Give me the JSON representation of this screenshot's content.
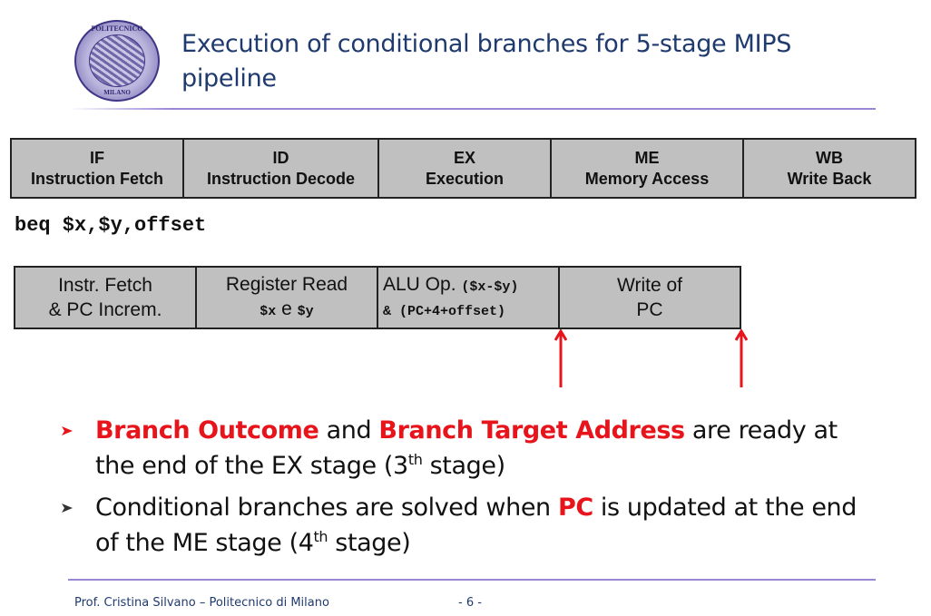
{
  "header": {
    "logo": {
      "top_text": "POLITECNICO",
      "bottom_text": "MILANO"
    },
    "title": "Execution of conditional branches for 5-stage MIPS pipeline"
  },
  "pipeline_stages": [
    {
      "abbr": "IF",
      "name": "Instruction Fetch"
    },
    {
      "abbr": "ID",
      "name": "Instruction Decode"
    },
    {
      "abbr": "EX",
      "name": "Execution"
    },
    {
      "abbr": "ME",
      "name": "Memory Access"
    },
    {
      "abbr": "WB",
      "name": "Write Back"
    }
  ],
  "instruction": "beq $x,$y,offset",
  "operations": [
    {
      "line1": "Instr. Fetch",
      "line2": "& PC Increm."
    },
    {
      "line1": "Register Read",
      "line2_a": "$x",
      "line2_b": " e ",
      "line2_c": "$y"
    },
    {
      "line1_a": "ALU Op. ",
      "line1_b": "($x-$y)",
      "line2": "& (PC+4+offset)"
    },
    {
      "line1": "Write of",
      "line2": "PC"
    }
  ],
  "arrows": [
    {
      "label": "end-of-EX-arrow",
      "color": "#e8141b"
    },
    {
      "label": "end-of-ME-arrow",
      "color": "#e8141b"
    }
  ],
  "bullets": [
    {
      "parts": [
        "Branch Outcome",
        " and ",
        "Branch Target Address",
        " are ready at the end of the EX stage (3",
        "th",
        " stage)"
      ]
    },
    {
      "parts": [
        "Conditional branches are solved when ",
        "PC",
        " is updated at the end of the ME stage (4",
        "th",
        " stage)"
      ]
    }
  ],
  "colors": {
    "title": "#1f3a6e",
    "highlight": "#e8141b",
    "rule": "#9b86d6",
    "stage_fill": "#c0c0c0"
  },
  "footer": {
    "author": "Prof. Cristina Silvano – Politecnico di Milano",
    "page": "- 6 -"
  }
}
